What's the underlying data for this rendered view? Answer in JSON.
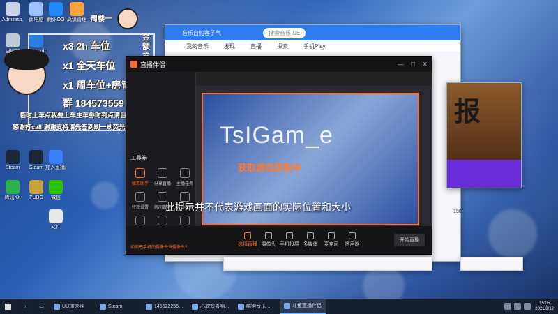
{
  "desktop": {
    "icons": [
      {
        "label": "Administr...",
        "color": "#c8d3e6"
      },
      {
        "label": "此电脑",
        "color": "#9bc4ff"
      },
      {
        "label": "腾讯QQ",
        "color": "#1e8cff"
      },
      {
        "label": "高级管理",
        "color": "#ffa23a"
      },
      {
        "label": "回收站",
        "color": "#c0c9d6"
      },
      {
        "label": "Microsoft Edge",
        "color": "#2d7de0"
      },
      {
        "label": "Steam",
        "color": "#1b2838"
      },
      {
        "label": "Steam",
        "color": "#1b2838"
      },
      {
        "label": "加入直播间",
        "color": "#3b80ff"
      },
      {
        "label": "腾讯XX",
        "color": "#2bb24c"
      },
      {
        "label": "PUBG",
        "color": "#c7a23c"
      },
      {
        "label": "微信",
        "color": "#2dc100"
      },
      {
        "label": "文件",
        "color": "#e8e8e8"
      }
    ]
  },
  "overlay": {
    "header_name": "周楼一",
    "lines": [
      "x3  2h 车位",
      "x1  全天车位",
      "x1  周车位+房管",
      "群  184573559"
    ],
    "notice1": "临时上车点我要上车主车劵时到点请自觉联系动",
    "notice2": "感谢打call 谢谢支持请先签到刷一刷荧光棒棒哈",
    "vertical": "金额主·刷礼白嫖"
  },
  "qq_music": {
    "title": "音乐台约客子气",
    "search_placeholder": "搜索音乐 UE",
    "tabs": [
      "我的音乐",
      "发现",
      "直播",
      "探索",
      "手机Play"
    ]
  },
  "stream_app": {
    "logo": "直播伴侣",
    "sidebar_title": "工具箱",
    "tools": [
      {
        "label": "弹幕助手"
      },
      {
        "label": "分享直播"
      },
      {
        "label": "主播任务"
      },
      {
        "label": "特效设置"
      },
      {
        "label": "房间管理"
      },
      {
        "label": "直播数据"
      },
      {
        "label": "虚拟形象"
      },
      {
        "label": "弹幕墙"
      },
      {
        "label": "歌词显示"
      }
    ],
    "watermark": "TsIGam_e",
    "subtitle_big": "此提示并不代表游戏画面的实际位置和大小",
    "subtitle_orange": "获取游戏获取中",
    "bottom_controls": [
      {
        "label": "选择直播"
      },
      {
        "label": "摄像头"
      },
      {
        "label": "手机投屏"
      },
      {
        "label": "多媒体"
      },
      {
        "label": "麦克风"
      },
      {
        "label": "扬声器"
      }
    ],
    "go_live": "开始直播",
    "tip": "如何把手机的摄像头当摄像头?"
  },
  "game_window": {
    "ad_text": "报",
    "counter": "198"
  },
  "taskbar": {
    "items": [
      {
        "label": "UU加速器",
        "active": false
      },
      {
        "label": "Steam",
        "active": false
      },
      {
        "label": "1456222553 - 只...",
        "active": false
      },
      {
        "label": "心软欢喜响(2248...",
        "active": false
      },
      {
        "label": "酷狗音乐 然后...",
        "active": false
      },
      {
        "label": "斗鱼直播伴侣",
        "active": true
      }
    ],
    "time": "15:05",
    "date": "2021/8/12"
  }
}
